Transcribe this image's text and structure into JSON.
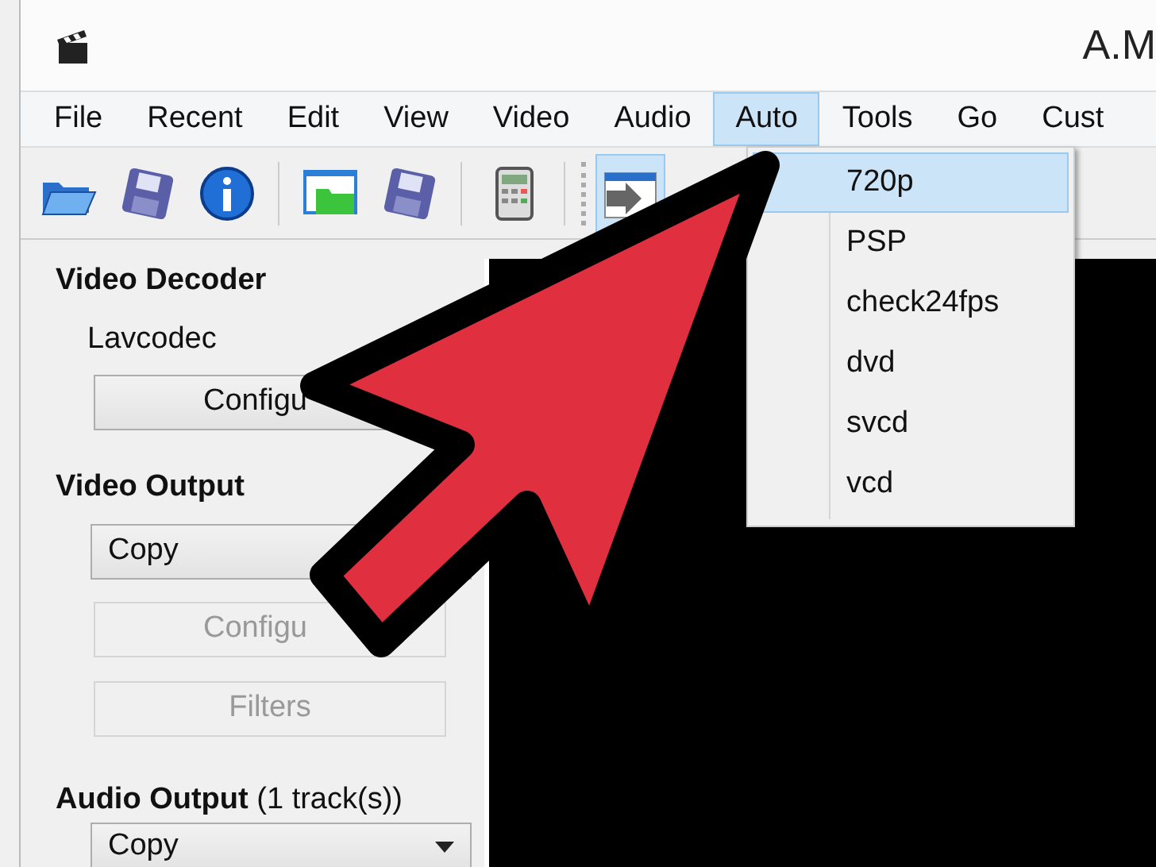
{
  "window": {
    "title": "A.M"
  },
  "menu": [
    {
      "label": "File",
      "selected": false
    },
    {
      "label": "Recent",
      "selected": false
    },
    {
      "label": "Edit",
      "selected": false
    },
    {
      "label": "View",
      "selected": false
    },
    {
      "label": "Video",
      "selected": false
    },
    {
      "label": "Audio",
      "selected": false
    },
    {
      "label": "Auto",
      "selected": true
    },
    {
      "label": "Tools",
      "selected": false
    },
    {
      "label": "Go",
      "selected": false
    },
    {
      "label": "Cust",
      "selected": false
    }
  ],
  "dropdown": [
    {
      "label": "720p",
      "selected": true
    },
    {
      "label": "PSP",
      "selected": false
    },
    {
      "label": "check24fps",
      "selected": false
    },
    {
      "label": "dvd",
      "selected": false
    },
    {
      "label": "svcd",
      "selected": false
    },
    {
      "label": "vcd",
      "selected": false
    }
  ],
  "panel": {
    "video_decoder": {
      "heading": "Video Decoder",
      "codec": "Lavcodec",
      "configure": {
        "label": "Configu",
        "disabled": false
      }
    },
    "video_output": {
      "heading": "Video Output",
      "select": "Copy",
      "configure": {
        "label": "Configu",
        "disabled": true
      },
      "filters": {
        "label": "Filters",
        "disabled": true
      }
    },
    "audio_output": {
      "heading": "Audio Output",
      "note": "(1 track(s))",
      "select": "Copy"
    }
  }
}
